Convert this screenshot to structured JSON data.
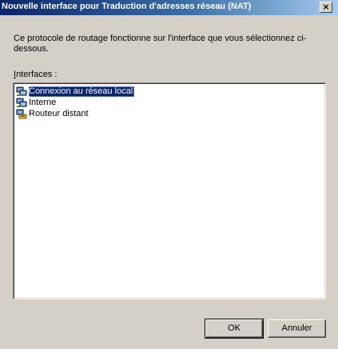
{
  "window": {
    "title": "Nouvelle interface pour Traduction d'adresses réseau (NAT)",
    "close_glyph": "×"
  },
  "description": "Ce protocole de routage fonctionne sur l'interface que vous sélectionnez ci-dessous.",
  "interfaces_label": {
    "accelerator": "I",
    "rest": "nterfaces :"
  },
  "interfaces": [
    {
      "label": "Connexion au réseau local",
      "icon": "network-connection-icon",
      "selected": true
    },
    {
      "label": "Interne",
      "icon": "network-connection-icon",
      "selected": false
    },
    {
      "label": "Routeur distant",
      "icon": "dial-up-router-icon",
      "selected": false
    }
  ],
  "buttons": {
    "ok": "OK",
    "cancel": "Annuler"
  },
  "colors": {
    "titlebar_start": "#0a246a",
    "titlebar_end": "#a6caf0",
    "selection": "#0a246a",
    "dialog_face": "#d4d0c8"
  }
}
